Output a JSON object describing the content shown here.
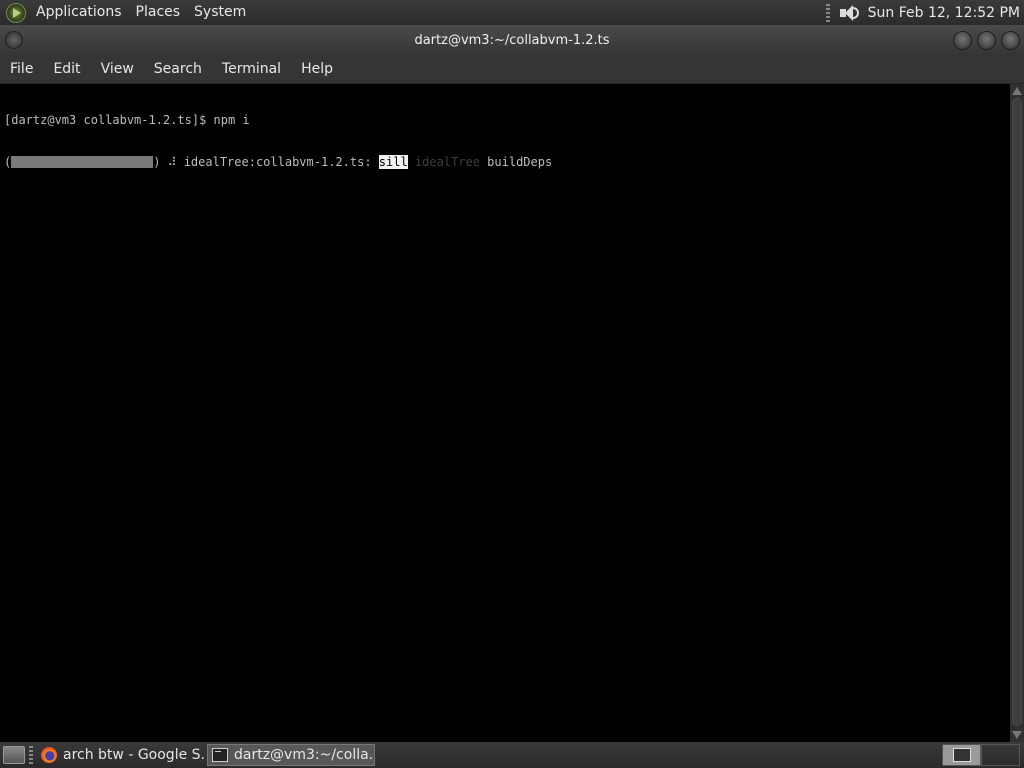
{
  "top_panel": {
    "menus": [
      "Applications",
      "Places",
      "System"
    ],
    "clock": "Sun Feb 12, 12:52 PM"
  },
  "window": {
    "title": "dartz@vm3:~/collabvm-1.2.ts"
  },
  "menubar": [
    "File",
    "Edit",
    "View",
    "Search",
    "Terminal",
    "Help"
  ],
  "terminal": {
    "line1": "[dartz@vm3 collabvm-1.2.ts]$ npm i",
    "line2_open": "(",
    "line2_close": ") ",
    "spinner": "⠼",
    "task_text": " idealTree:collabvm-1.2.ts: ",
    "level": "sill",
    "dim_text": " idealTree ",
    "final_text": "buildDeps"
  },
  "taskbar": {
    "tasks": [
      "arch btw - Google S...",
      "dartz@vm3:~/colla..."
    ]
  }
}
